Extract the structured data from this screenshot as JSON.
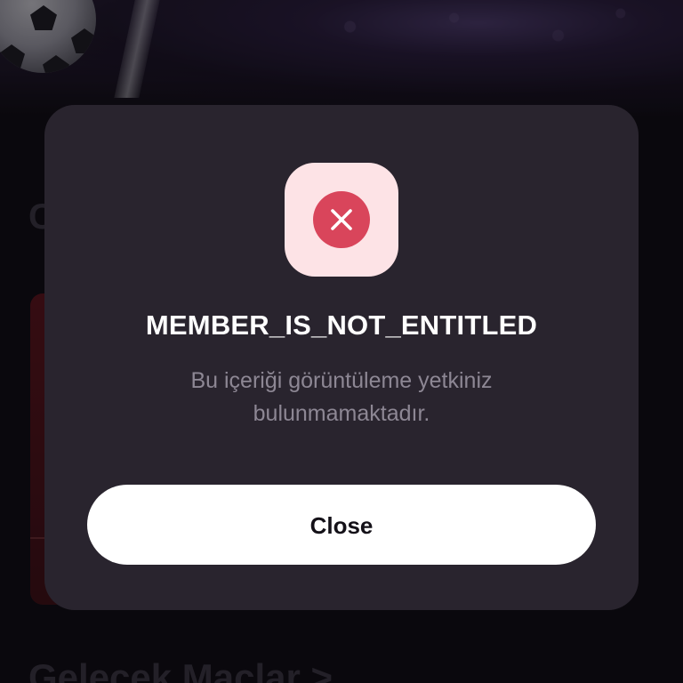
{
  "background": {
    "section_letter": "C",
    "bottom_title": "Gelecek Maçlar >"
  },
  "dialog": {
    "icon": "error-x-icon",
    "title": "MEMBER_IS_NOT_ENTITLED",
    "message": "Bu içeriği görüntüleme yetkiniz bulunmamaktadır.",
    "close_label": "Close"
  },
  "colors": {
    "modal_bg": "#29242e",
    "icon_tile_bg": "#fde3e6",
    "error_red": "#d9455b",
    "button_bg": "#ffffff"
  }
}
